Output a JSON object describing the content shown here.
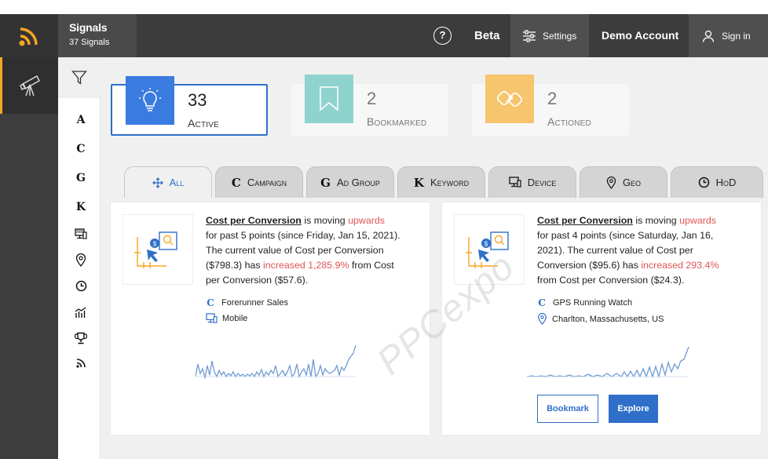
{
  "header": {
    "app_title": "Signals",
    "signal_count": "37 Signals",
    "help_label": "?",
    "beta_label": "Beta",
    "settings_label": "Settings",
    "account_label": "Demo Account",
    "signin_label": "Sign in"
  },
  "filters": {
    "items": [
      {
        "label": "A"
      },
      {
        "label": "C"
      },
      {
        "label": "G"
      },
      {
        "label": "K"
      }
    ]
  },
  "stats": [
    {
      "value": "33",
      "label": "Active",
      "color": "#3a7be0"
    },
    {
      "value": "2",
      "label": "Bookmarked",
      "color": "#8fd3cf"
    },
    {
      "value": "2",
      "label": "Actioned",
      "color": "#f6c56e"
    }
  ],
  "tabs": [
    {
      "code": "",
      "label": "All",
      "active": true
    },
    {
      "code": "C",
      "label": "Campaign"
    },
    {
      "code": "G",
      "label": "Ad Group"
    },
    {
      "code": "K",
      "label": "Keyword"
    },
    {
      "code": "",
      "label": "Device"
    },
    {
      "code": "",
      "label": "Geo"
    },
    {
      "code": "",
      "label": "HoD"
    }
  ],
  "cards": [
    {
      "metric": "Cost per Conversion",
      "text_is_moving": " is moving ",
      "direction": "upwards",
      "line2": "for past 5 points (since Friday, Jan 15, 2021).",
      "line3": "The current value of Cost per Conversion",
      "line4_pre": "($798.3) has ",
      "change": "increased 1,285.9%",
      "line4_post": " from Cost",
      "line5": "per Conversion ($57.6).",
      "campaign_code": "C",
      "campaign": "Forerunner Sales",
      "secondary": "Mobile"
    },
    {
      "metric": "Cost per Conversion",
      "text_is_moving": " is moving ",
      "direction": "upwards",
      "line2": "for past 4 points (since Saturday, Jan 16,",
      "line3": "2021). The current value of Cost per",
      "line4_pre": "Conversion ($95.6) has ",
      "change": "increased 293.4%",
      "line4_post": "",
      "line5": "from Cost per Conversion ($24.3).",
      "campaign_code": "C",
      "campaign": "GPS Running Watch",
      "secondary": "Charlton, Massachusetts, US",
      "bookmark_label": "Bookmark",
      "explore_label": "Explore"
    }
  ],
  "watermark": "PPCexpo",
  "colors": {
    "accent": "#2f6fc9",
    "highlight": "#e05454",
    "sidebar_accent": "#f5a623"
  }
}
